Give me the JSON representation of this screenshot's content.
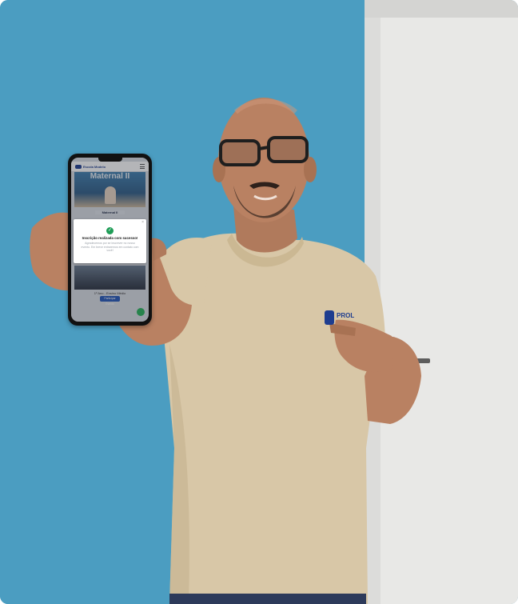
{
  "phone": {
    "brand_name": "Escola Modelo",
    "hero_title": "Maternal II",
    "level_label": "Maternal II",
    "modal": {
      "close": "×",
      "check": "✓",
      "title": "Inscrição realizada com sucesso!",
      "body": "Agradecemos por se inscrever no nosso evento. Em breve entraremos em contato com você!"
    },
    "class_name": "1º Ano - Ensino Médio",
    "enroll_button": "Participar Evento"
  },
  "shirt_logo_text": "PROL",
  "colors": {
    "wall": "#4b9dc1",
    "door": "#e6e6e4",
    "shirt": "#d8c7a7",
    "brand_blue": "#1e3d8f",
    "success_green": "#1f9d57",
    "button_blue": "#2456b8"
  }
}
